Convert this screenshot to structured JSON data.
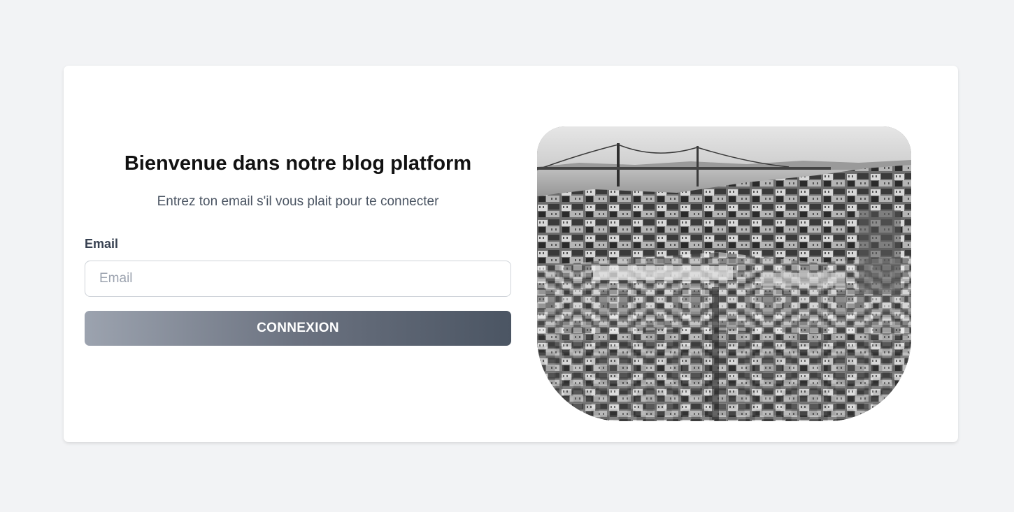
{
  "login": {
    "title": "Bienvenue dans notre blog platform",
    "subtitle": "Entrez ton email s'il vous plait pour te connecter",
    "email_label": "Email",
    "email_placeholder": "Email",
    "email_value": "",
    "submit_label": "CONNEXION"
  },
  "hero_image": {
    "description_icon": "city-photo",
    "style": "black-and-white"
  },
  "colors": {
    "page_background": "#f2f3f5",
    "card_background": "#ffffff",
    "button_gradient_start": "#9ca3af",
    "button_gradient_end": "#4b5563"
  }
}
